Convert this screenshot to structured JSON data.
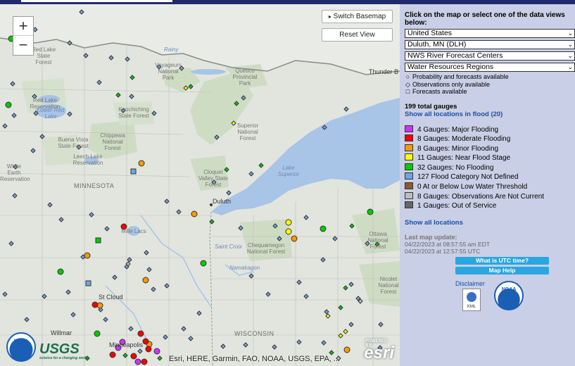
{
  "map": {
    "zoom_in_label": "+",
    "zoom_out_label": "−",
    "switch_basemap_label": "Switch Basemap",
    "reset_view_label": "Reset View",
    "attribution": "Esri, HERE, Garmin, FAO, NOAA, USGS, EPA, ...",
    "esri_logo": "esri",
    "esri_powered": "POWERED BY",
    "noaa_logo_text": "NOAA",
    "usgs_logo_text": "USGS",
    "usgs_tagline": "science for a changing world",
    "labels": {
      "minnesota": "MINNESOTA",
      "wisconsin": "WISCONSIN",
      "lake_superior": "Lake Superior",
      "duluth": "Duluth",
      "st_cloud": "St Cloud",
      "minneapolis": "Minneapolis",
      "willmar": "Willmar",
      "thunder_bay": "Thunder B",
      "rainy": "Rainy",
      "saint_croix": "Saint Croix",
      "namakagon": "Namakagon",
      "lower_red_lake": "Lower Red Lake",
      "red_lake_reservation": "Red Lake Reservation",
      "leech_lake_reservation": "Leech Lake Reservation",
      "white_earth_reservation": "White Earth Reservation",
      "chippewa_nf": "Chippewa National Forest",
      "buena_vista_sf": "Buena Vista State Forest",
      "kooching_sf": "Koochiching State Forest",
      "superior_nf": "Superior National Forest",
      "voyageurs_np": "Voyageurs National Park",
      "quetico_pp": "Quetico Provincial Park",
      "cloquet_sf": "Cloquet Valley State Forest",
      "chequamegon_nf": "Chequamegon National Forest",
      "ottawa_nf": "Ottawa National Forest",
      "nicolet_nf": "Nicolet National Forest",
      "red_lake_sf": "Red Lake State Forest",
      "mille_lacs": "Mille Lacs"
    }
  },
  "panel": {
    "instructions": "Click on the map or select one of the data views below:",
    "selects": [
      "United States",
      "Duluth, MN (DLH)",
      "NWS River Forecast Centers",
      "Water Resources Regions"
    ],
    "key": [
      {
        "symbol": "○",
        "label": "Probability and forecasts available"
      },
      {
        "symbol": "◇",
        "label": "Observations only available"
      },
      {
        "symbol": "□",
        "label": "Forecasts available"
      }
    ],
    "total_gauges": "199 total gauges",
    "show_flood_link": "Show all locations in flood (20)",
    "categories": [
      {
        "label": "4 Gauges: Major Flooding",
        "color": "#cc33ff"
      },
      {
        "label": "8 Gauges: Moderate Flooding",
        "color": "#ff0000"
      },
      {
        "label": "8 Gauges: Minor Flooding",
        "color": "#ff9900"
      },
      {
        "label": "11 Gauges: Near Flood Stage",
        "color": "#ffff00"
      },
      {
        "label": "32 Gauges: No Flooding",
        "color": "#00cc00"
      },
      {
        "label": "127 Flood Category Not Defined",
        "color": "#72a4e0"
      },
      {
        "label": "0 At or Below Low Water Threshold",
        "color": "#8b5a2b"
      },
      {
        "label": "8 Gauges: Observations Are Not Current",
        "color": "#bdbdbd"
      },
      {
        "label": "1 Gauges: Out of Service",
        "color": "#666666"
      }
    ],
    "show_all_link": "Show all locations",
    "last_update_label": "Last map update:",
    "update_edt": "04/22/2023 at 08:57:55 am EDT",
    "update_utc": "04/22/2023 at 12:57:55 UTC",
    "utc_button": "What is UTC time?",
    "help_button": "Map Help",
    "disclaimer_link": "Disclaimer",
    "kml_label": "KML",
    "noaa_text": "NOAA"
  }
}
